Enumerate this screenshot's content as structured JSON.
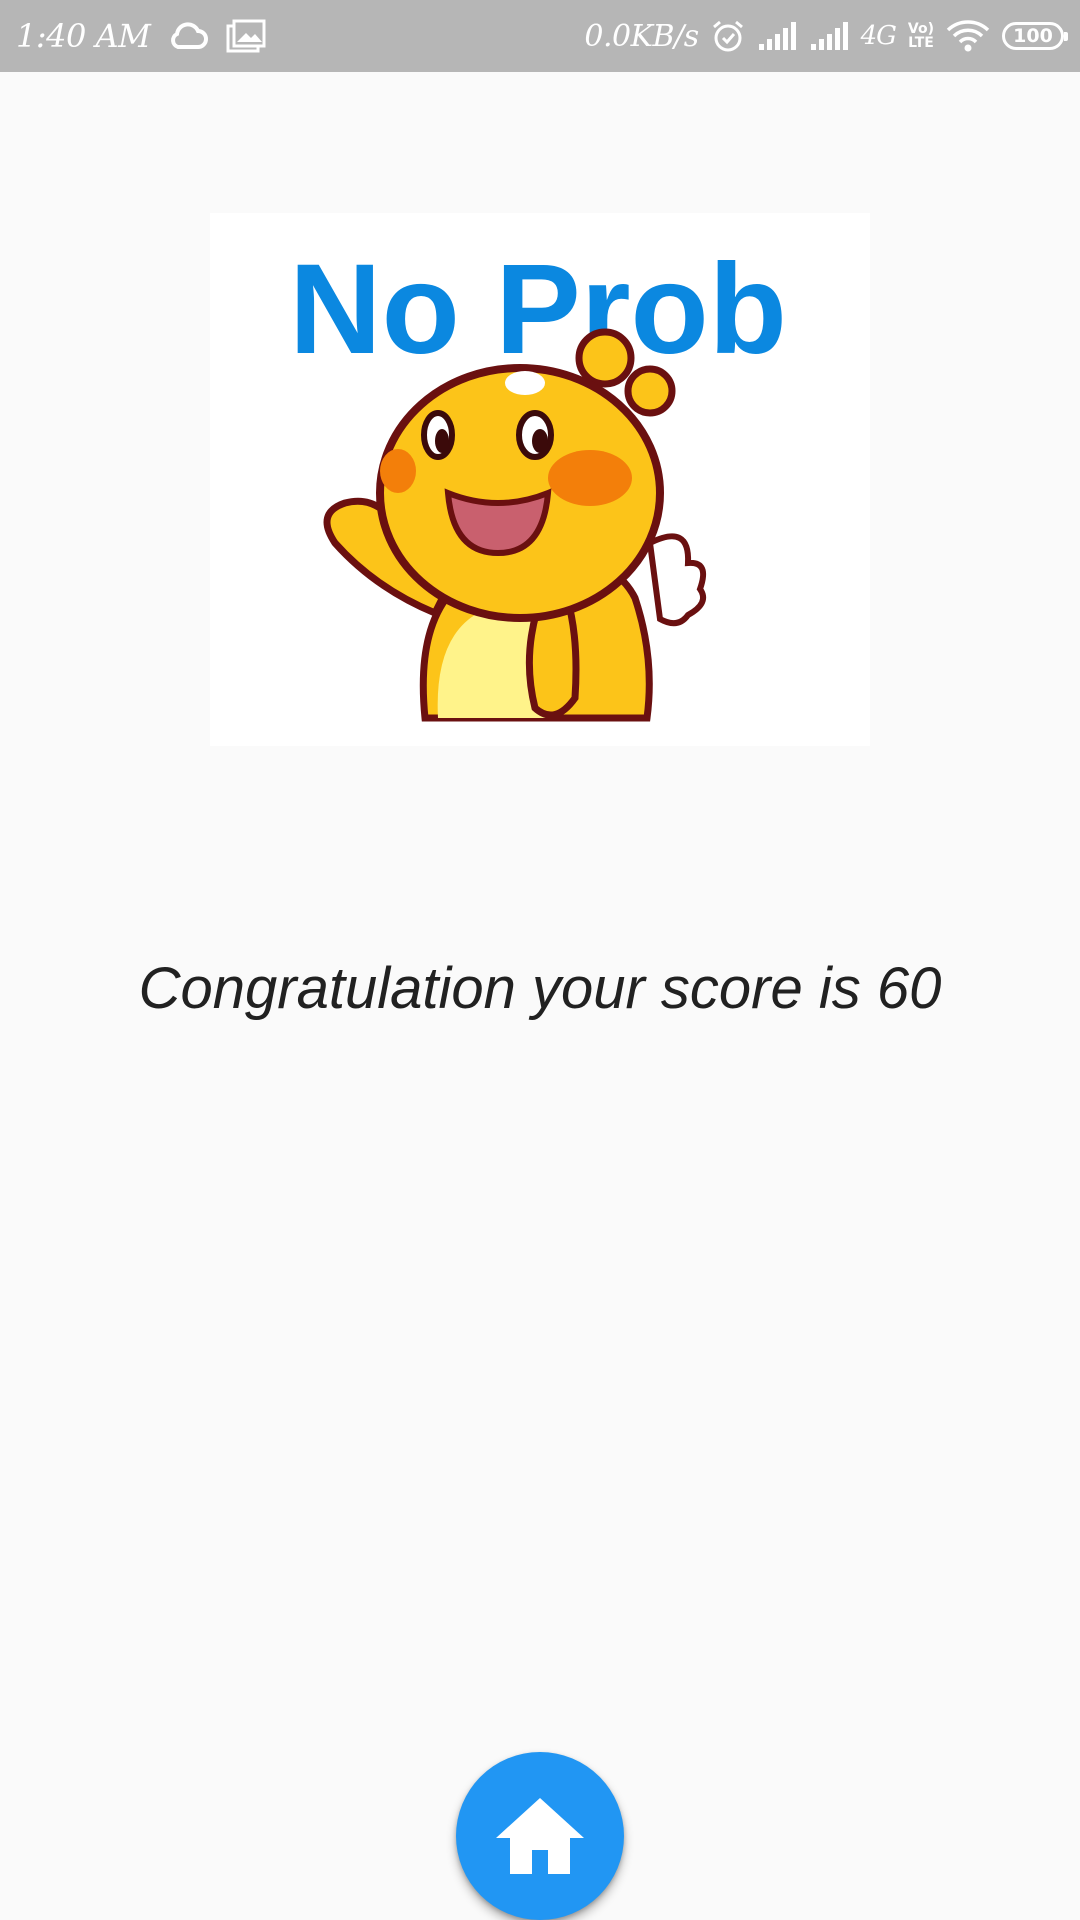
{
  "status_bar": {
    "time": "1:40 AM",
    "net_speed": "0.0KB/s",
    "network_type": "4G",
    "volte_top": "Vo)",
    "volte_bottom": "LTE",
    "battery": "100",
    "icons": [
      "cloud-icon",
      "gallery-icon",
      "alarm-icon",
      "signal-icon",
      "signal-icon",
      "wifi-icon",
      "battery-icon"
    ]
  },
  "sticker": {
    "caption": "No Prob",
    "icon": "waving-duck-sticker"
  },
  "result": {
    "message": "Congratulation your score is 60"
  },
  "fab": {
    "icon": "home-icon"
  },
  "colors": {
    "status_bar_bg": "#b6b6b6",
    "background": "#fafafa",
    "fab": "#2196f3",
    "text": "#212121",
    "sticker_text": "#0b88e0"
  }
}
